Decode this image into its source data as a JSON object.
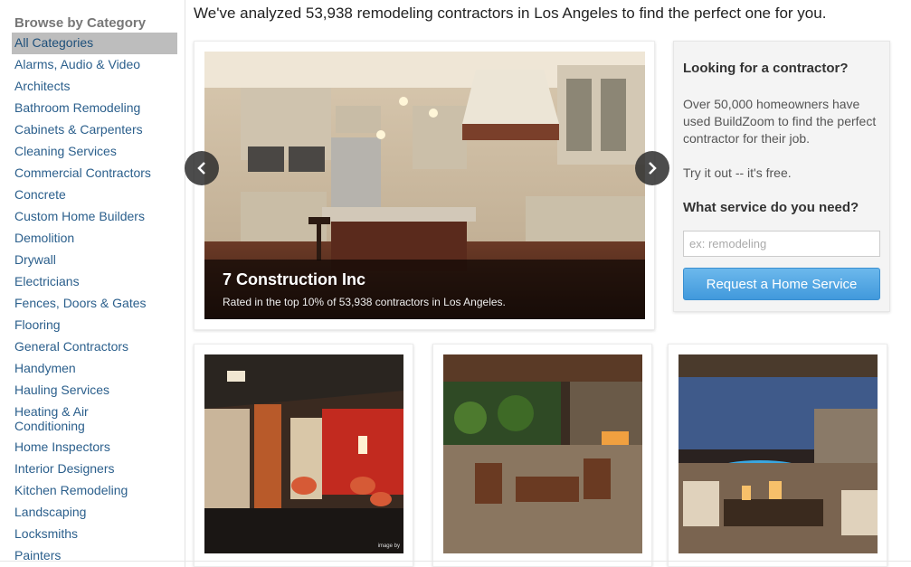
{
  "sidebar": {
    "title": "Browse by Category",
    "items": [
      {
        "label": "All Categories",
        "selected": true
      },
      {
        "label": "Alarms, Audio & Video"
      },
      {
        "label": "Architects"
      },
      {
        "label": "Bathroom Remodeling"
      },
      {
        "label": "Cabinets & Carpenters"
      },
      {
        "label": "Cleaning Services"
      },
      {
        "label": "Commercial Contractors"
      },
      {
        "label": "Concrete"
      },
      {
        "label": "Custom Home Builders"
      },
      {
        "label": "Demolition"
      },
      {
        "label": "Drywall"
      },
      {
        "label": "Electricians"
      },
      {
        "label": "Fences, Doors & Gates"
      },
      {
        "label": "Flooring"
      },
      {
        "label": "General Contractors"
      },
      {
        "label": "Handymen"
      },
      {
        "label": "Hauling Services"
      },
      {
        "label": "Heating & Air Conditioning"
      },
      {
        "label": "Home Inspectors"
      },
      {
        "label": "Interior Designers"
      },
      {
        "label": "Kitchen Remodeling"
      },
      {
        "label": "Landscaping"
      },
      {
        "label": "Locksmiths"
      },
      {
        "label": "Painters"
      }
    ]
  },
  "headline": "We've analyzed 53,938 remodeling contractors in Los Angeles to find the perfect one for you.",
  "carousel": {
    "caption_title": "7 Construction Inc",
    "caption_subtitle": "Rated in the top 10% of 53,938 contractors in Los Angeles.",
    "prev_icon": "chevron-left-icon",
    "next_icon": "chevron-right-icon"
  },
  "panel": {
    "title": "Looking for a contractor?",
    "text": "Over 50,000 homeowners have used BuildZoom to find the perfect contractor for their job.",
    "try_text": "Try it out -- it's free.",
    "question": "What service do you need?",
    "input_placeholder": "ex: remodeling",
    "input_value": "",
    "button_label": "Request a Home Service"
  },
  "thumbnails": [
    {
      "name": "interior-lounge-photo",
      "credit": "image by"
    },
    {
      "name": "patio-fireplace-photo"
    },
    {
      "name": "backyard-pool-photo"
    }
  ],
  "colors": {
    "link": "#2b5f8c",
    "selected_bg": "#bdbdbd",
    "button_top": "#6cb8ec",
    "button_bottom": "#4199dc"
  }
}
